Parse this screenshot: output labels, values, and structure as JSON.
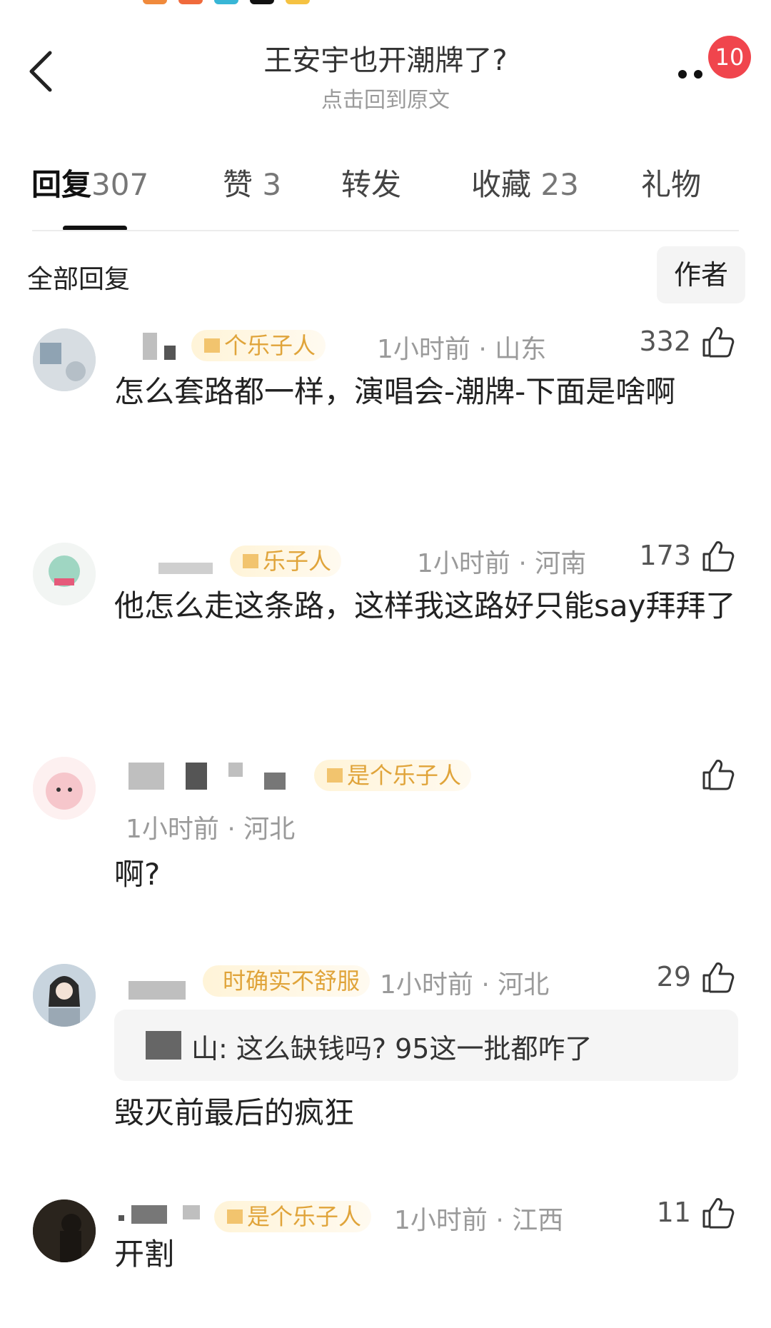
{
  "header": {
    "title": "王安宇也开潮牌了?",
    "subtitle": "点击回到原文",
    "badge": "10"
  },
  "tabs": [
    {
      "label": "回复",
      "count": "307"
    },
    {
      "label": "赞",
      "count": "3"
    },
    {
      "label": "转发",
      "count": ""
    },
    {
      "label": "收藏",
      "count": "23"
    },
    {
      "label": "礼物",
      "count": ""
    }
  ],
  "section": {
    "title": "全部回复",
    "author_filter": "作者"
  },
  "comments": [
    {
      "tag": "个乐子人",
      "time_location": "1小时前 · 山东",
      "likes": "332",
      "text": "怎么套路都一样，演唱会-潮牌-下面是啥啊"
    },
    {
      "tag": "乐子人",
      "time_location": "1小时前 · 河南",
      "likes": "173",
      "text": "他怎么走这条路，这样我这路好只能say拜拜了"
    },
    {
      "tag": "是个乐子人",
      "time_location": "1小时前 · 河北",
      "likes": "",
      "text": "啊?"
    },
    {
      "tag": "时确实不舒服",
      "time_location": "1小时前 · 河北",
      "likes": "29",
      "quote": "山: 这么缺钱吗? 95这一批都咋了",
      "text": "毁灭前最后的疯狂"
    },
    {
      "tag": "是个乐子人",
      "time_location": "1小时前 · 江西",
      "likes": "11",
      "text": "开割"
    }
  ],
  "colors": {
    "badge": "#f0454d",
    "tag_text": "#e0a43a",
    "meta": "#9a9a9a"
  }
}
